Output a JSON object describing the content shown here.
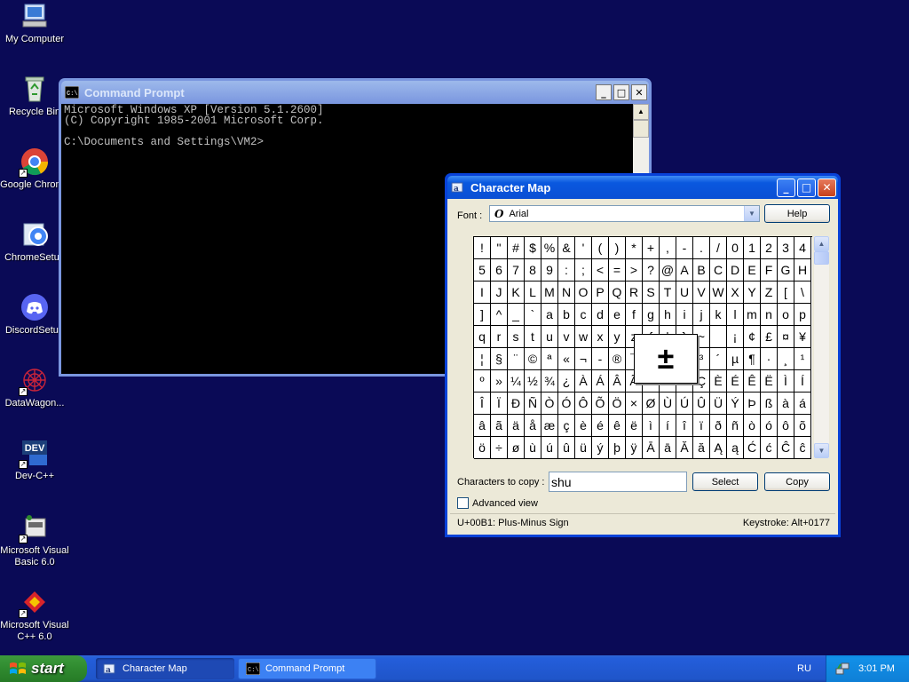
{
  "desktop_icons": [
    {
      "label": "My Computer",
      "icon": "computer-icon"
    },
    {
      "label": "Recycle Bin",
      "icon": "recycle-bin-icon"
    },
    {
      "label": "Google Chrome",
      "icon": "chrome-icon"
    },
    {
      "label": "ChromeSetup",
      "icon": "chrome-setup-icon"
    },
    {
      "label": "DiscordSetup",
      "icon": "discord-icon"
    },
    {
      "label": "DataWagon...",
      "icon": "datawagon-icon"
    },
    {
      "label": "Dev-C++",
      "icon": "devcpp-icon"
    },
    {
      "label": "Microsoft Visual Basic 6.0",
      "icon": "vb6-icon"
    },
    {
      "label": "Microsoft Visual C++ 6.0",
      "icon": "vc6-icon"
    }
  ],
  "cmd": {
    "title": "Command Prompt",
    "console_text": "Microsoft Windows XP [Version 5.1.2600]\n(C) Copyright 1985-2001 Microsoft Corp.\n\nC:\\Documents and Settings\\VM2>"
  },
  "charmap": {
    "title": "Character Map",
    "font_label": "Font :",
    "font_value": "Arial",
    "help_label": "Help",
    "chars": [
      "!",
      "\"",
      "#",
      "$",
      "%",
      "&",
      "'",
      "(",
      ")",
      "*",
      "+",
      ",",
      "-",
      ".",
      "/",
      "0",
      "1",
      "2",
      "3",
      "4",
      "5",
      "6",
      "7",
      "8",
      "9",
      ":",
      ";",
      "<",
      "=",
      ">",
      "?",
      "@",
      "A",
      "B",
      "C",
      "D",
      "E",
      "F",
      "G",
      "H",
      "I",
      "J",
      "K",
      "L",
      "M",
      "N",
      "O",
      "P",
      "Q",
      "R",
      "S",
      "T",
      "U",
      "V",
      "W",
      "X",
      "Y",
      "Z",
      "[",
      "\\",
      "]",
      "^",
      "_",
      "`",
      "a",
      "b",
      "c",
      "d",
      "e",
      "f",
      "g",
      "h",
      "i",
      "j",
      "k",
      "l",
      "m",
      "n",
      "o",
      "p",
      "q",
      "r",
      "s",
      "t",
      "u",
      "v",
      "w",
      "x",
      "y",
      "z",
      "{",
      "|",
      "}",
      "~",
      " ",
      "¡",
      "¢",
      "£",
      "¤",
      "¥",
      "¦",
      "§",
      "¨",
      "©",
      "ª",
      "«",
      "¬",
      "-",
      "®",
      "¯",
      "°",
      "±",
      "²",
      "³",
      "´",
      "µ",
      "¶",
      "·",
      "¸",
      "¹",
      "º",
      "»",
      "¼",
      "½",
      "¾",
      "¿",
      "À",
      "Á",
      "Â",
      "Ã",
      "Ä",
      "Å",
      "Æ",
      "Ç",
      "È",
      "É",
      "Ê",
      "Ë",
      "Ì",
      "Í",
      "Î",
      "Ï",
      "Ð",
      "Ñ",
      "Ò",
      "Ó",
      "Ô",
      "Õ",
      "Ö",
      "×",
      "Ø",
      "Ù",
      "Ú",
      "Û",
      "Ü",
      "Ý",
      "Þ",
      "ß",
      "à",
      "á",
      "â",
      "ã",
      "ä",
      "å",
      "æ",
      "ç",
      "è",
      "é",
      "ê",
      "ë",
      "ì",
      "í",
      "î",
      "ï",
      "ð",
      "ñ",
      "ò",
      "ó",
      "ô",
      "õ",
      "ö",
      "÷",
      "ø",
      "ù",
      "ú",
      "û",
      "ü",
      "ý",
      "þ",
      "ÿ",
      "Ā",
      "ā",
      "Ă",
      "ă",
      "Ą",
      "ą",
      "Ć",
      "ć",
      "Ĉ",
      "ĉ"
    ],
    "selected_char": "±",
    "copy_label": "Characters to copy :",
    "copy_value": "shu",
    "select_label": "Select",
    "copy_button": "Copy",
    "advanced_label": "Advanced view",
    "advanced_checked": false,
    "status_left": "U+00B1: Plus-Minus Sign",
    "status_right": "Keystroke: Alt+0177"
  },
  "taskbar": {
    "start_label": "start",
    "tasks": [
      {
        "label": "Character Map",
        "active": true
      },
      {
        "label": "Command Prompt",
        "active": false
      }
    ],
    "language": "RU",
    "clock": "3:01 PM"
  }
}
